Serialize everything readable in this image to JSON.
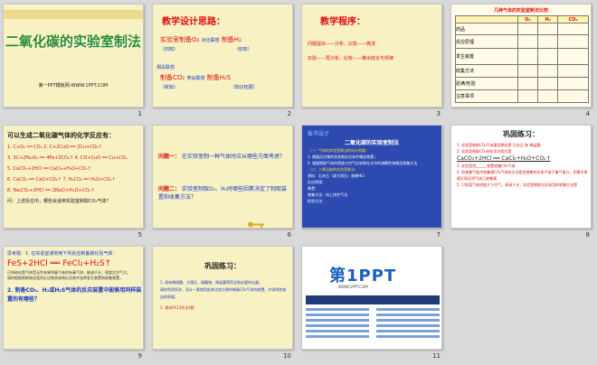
{
  "slides": [
    {
      "num": "1",
      "title": "二氧化碳的实验室制法",
      "footer": "第一PPT模板网-WWW.1PPT.COM"
    },
    {
      "num": "2",
      "heading": "教学设计思路：",
      "line1": {
        "a": "实验室制备O₂",
        "a_note": "（旧知）",
        "link": "对比联想",
        "b": "制备H₂",
        "b_note": "（旧知）"
      },
      "line2": {
        "pre": "相关联想",
        "a": "制备CO₂",
        "a_note": "（新知）",
        "link": "类似联想",
        "b": "制备H₂S",
        "b_note": "（知识拓展）"
      }
    },
    {
      "num": "3",
      "heading": "教学程序：",
      "lines": [
        "问题提出——分析、比较——微流",
        "实验——再分析、比较——推出结论与规律"
      ]
    },
    {
      "num": "4",
      "title": "几种气体的实验室制法比较",
      "headers": [
        "",
        "O₂",
        "H₂",
        "CO₂"
      ],
      "rows": [
        [
          "药品",
          "",
          "",
          ""
        ],
        [
          "反应原理",
          "",
          "",
          ""
        ],
        [
          "发生装置",
          "",
          "",
          ""
        ],
        [
          "收集方法",
          "",
          "",
          ""
        ],
        [
          "验满/检验",
          "",
          "",
          ""
        ],
        [
          "注意事项",
          "",
          "",
          ""
        ]
      ]
    },
    {
      "num": "5",
      "heading": "可以生成二氧化碳气体的化学反应有：",
      "lines": [
        "1. C+O₂ ══ CO₂    2. C+2CuO ══ 2Cu+CO₂↑",
        "3. 3C+2Fe₂O₃ ══ 4Fe+3CO₂↑    4. CO+CuO ══ Cu+CO₂",
        "5. CaCO₃+2HCl ══ CaCl₂+H₂O+CO₂↑",
        "6. CaCO₃ ══ CaO+CO₂↑    7. H₂CO₃ ══ H₂O+CO₂↑",
        "8. Na₂CO₃+2HCl ══ 2NaCl+H₂O+CO₂↑",
        "问：上述反应中，哪些会适用实验室制取CO₂气体？"
      ]
    },
    {
      "num": "6",
      "q1_label": "问题一：",
      "q1": "在实验室制一种气体时应从哪些方面考虑？",
      "q2_label": "问题二：",
      "q2": "实验室制取O₂、H₂时哪些因素决定了制取装置和收集方法？"
    },
    {
      "num": "7",
      "tag": "板书设计",
      "heading": "二氧化碳的实验室制法",
      "lines": [
        "（一）气体的实验室制法的设计思路：",
        "1. 根据反应物的状态和反应条件确定装置；",
        "2. 根据制取气体的密度与空气比较和在水中的溶解性来确定收集方法",
        "（二）二氧化碳的实验室制法：",
        "原料：石灰石（或大理石）和稀HCl",
        "反应原理：",
        "装置：",
        "收集方法：向上排空气法",
        "检验方法："
      ]
    },
    {
      "num": "8",
      "heading": "巩固练习：",
      "lines": [
        "1. 实验室制取CO₂气体要用原料是 石灰石 和 稀盐酸",
        "2. 实验室制取CO₂的化学方程式是",
        "CaCO₃+2HCl ══ CaCl₂+H₂O+CO₂↑",
        "3. 实验室用______装置收集CO₂气体",
        "4. 检查集气瓶中收集满CO₂气体的方法是用燃着的木条平放于集气瓶口，如果木条熄灭则证明气体已收集满",
        "5. 已知某气体密度大于空气，易溶于水，实验室制取它应采用的收集方法是"
      ]
    },
    {
      "num": "9",
      "lines": [
        "思考题：1. 在实验室通常用下列反应制备硫化氢气体：",
        "FeS+2HCl ══ FeCl₂+H₂S↑",
        "已知硫化氢气体是无色有臭鸡蛋气味的有毒气体，能溶于水，密度比空气大。",
        "请你根据制取硫化氢的反应物状态和反应条件选择发生装置和收集装置。",
        "2. 制备CO₂、H₂或H₂S气体的反应装置中能够用同样装置的有哪些？"
      ]
    },
    {
      "num": "10",
      "heading": "巩固练习：",
      "lines": [
        "1. 现有稀硫酸、大理石、碳酸钠、稀盐酸等药品和必要的仪器，",
        "请你利用所学，设计一套使用起来比较方便的制备CO₂气体的装置，并说明其各自的原理。",
        "2. 课本P113作业4题"
      ]
    },
    {
      "num": "11",
      "logo": "第1PPT",
      "logo_sub": "WWW.1PPT.COM"
    }
  ]
}
